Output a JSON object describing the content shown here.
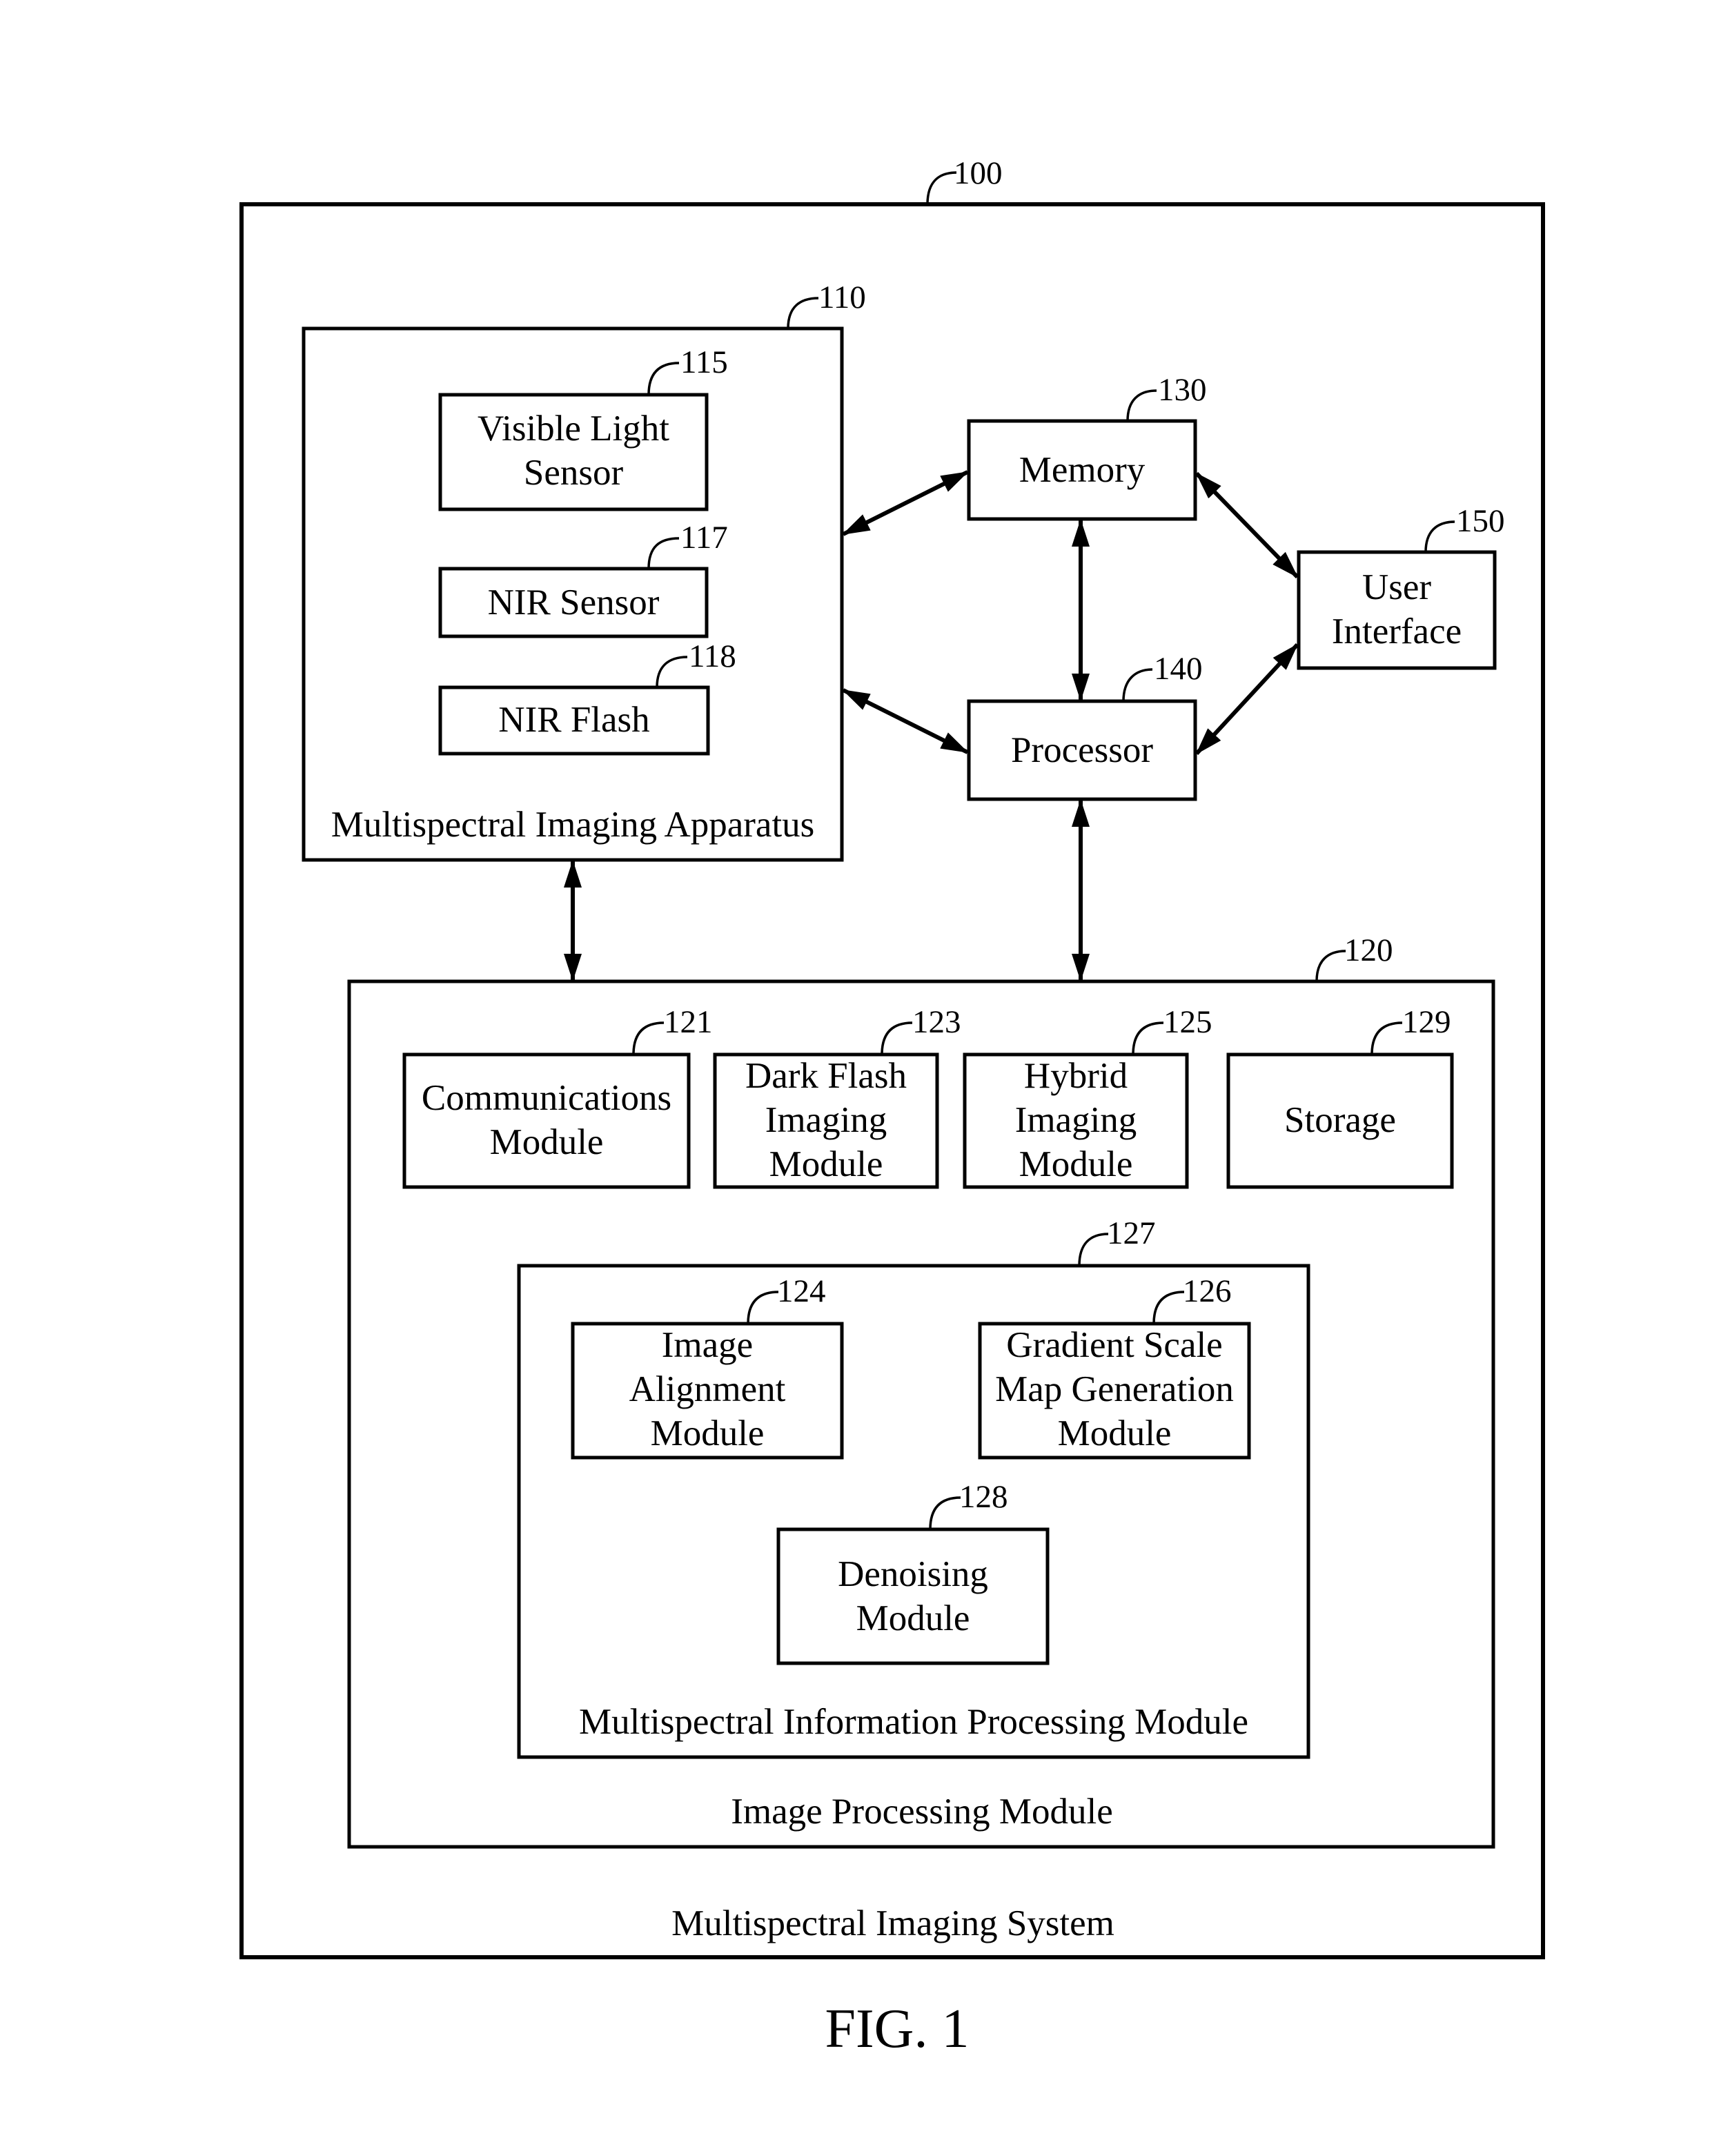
{
  "figure": {
    "caption": "FIG. 1",
    "system": {
      "ref": "100",
      "label": "Multispectral Imaging System"
    },
    "apparatus": {
      "ref": "110",
      "label": "Multispectral Imaging Apparatus",
      "components": [
        {
          "ref": "115",
          "lines": [
            "Visible Light",
            "Sensor"
          ]
        },
        {
          "ref": "117",
          "lines": [
            "NIR Sensor"
          ]
        },
        {
          "ref": "118",
          "lines": [
            "NIR Flash"
          ]
        }
      ]
    },
    "memory": {
      "ref": "130",
      "lines": [
        "Memory"
      ]
    },
    "processor": {
      "ref": "140",
      "lines": [
        "Processor"
      ]
    },
    "user_interface": {
      "ref": "150",
      "lines": [
        "User",
        "Interface"
      ]
    },
    "image_processing": {
      "ref": "120",
      "label": "Image Processing Module",
      "modules": [
        {
          "ref": "121",
          "lines": [
            "Communications",
            "Module"
          ]
        },
        {
          "ref": "123",
          "lines": [
            "Dark Flash",
            "Imaging",
            "Module"
          ]
        },
        {
          "ref": "125",
          "lines": [
            "Hybrid",
            "Imaging",
            "Module"
          ]
        },
        {
          "ref": "129",
          "lines": [
            "Storage"
          ]
        }
      ],
      "multispectral_info": {
        "ref": "127",
        "label": "Multispectral Information Processing Module",
        "modules": [
          {
            "ref": "124",
            "lines": [
              "Image",
              "Alignment",
              "Module"
            ]
          },
          {
            "ref": "126",
            "lines": [
              "Gradient Scale",
              "Map Generation",
              "Module"
            ]
          },
          {
            "ref": "128",
            "lines": [
              "Denoising",
              "Module"
            ]
          }
        ]
      }
    },
    "connections": [
      {
        "from": "110",
        "to": "130",
        "type": "bidirectional"
      },
      {
        "from": "110",
        "to": "140",
        "type": "bidirectional"
      },
      {
        "from": "130",
        "to": "140",
        "type": "bidirectional"
      },
      {
        "from": "130",
        "to": "150",
        "type": "bidirectional"
      },
      {
        "from": "140",
        "to": "150",
        "type": "bidirectional"
      },
      {
        "from": "110",
        "to": "120",
        "type": "bidirectional"
      },
      {
        "from": "140",
        "to": "120",
        "type": "bidirectional"
      }
    ]
  }
}
